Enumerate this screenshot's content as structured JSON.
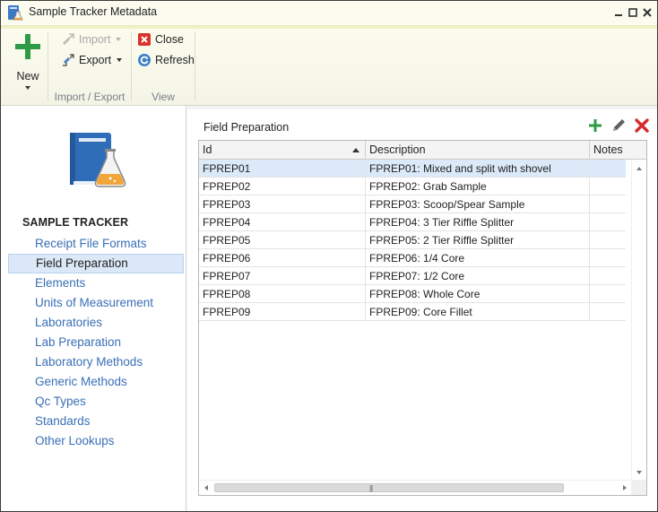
{
  "window": {
    "title": "Sample Tracker Metadata"
  },
  "ribbon": {
    "new_label": "New",
    "import_label": "Import",
    "export_label": "Export",
    "close_label": "Close",
    "refresh_label": "Refresh",
    "group_import_export": "Import / Export",
    "group_view": "View"
  },
  "nav": {
    "title": "SAMPLE TRACKER",
    "items": [
      "Receipt File Formats",
      "Field Preparation",
      "Elements",
      "Units of Measurement",
      "Laboratories",
      "Lab Preparation",
      "Laboratory Methods",
      "Generic Methods",
      "Qc Types",
      "Standards",
      "Other Lookups"
    ],
    "selected": "Field Preparation"
  },
  "content": {
    "title": "Field Preparation",
    "columns": [
      "Id",
      "Description",
      "Notes"
    ],
    "rows": [
      {
        "id": "FPREP01",
        "description": "FPREP01: Mixed and split with shovel",
        "notes": ""
      },
      {
        "id": "FPREP02",
        "description": "FPREP02: Grab Sample",
        "notes": ""
      },
      {
        "id": "FPREP03",
        "description": "FPREP03: Scoop/Spear Sample",
        "notes": ""
      },
      {
        "id": "FPREP04",
        "description": "FPREP04: 3 Tier Riffle Splitter",
        "notes": ""
      },
      {
        "id": "FPREP05",
        "description": "FPREP05: 2 Tier Riffle Splitter",
        "notes": ""
      },
      {
        "id": "FPREP06",
        "description": "FPREP06: 1/4 Core",
        "notes": ""
      },
      {
        "id": "FPREP07",
        "description": "FPREP07: 1/2 Core",
        "notes": ""
      },
      {
        "id": "FPREP08",
        "description": "FPREP08: Whole Core",
        "notes": ""
      },
      {
        "id": "FPREP09",
        "description": "FPREP09: Core Fillet",
        "notes": ""
      }
    ],
    "selected_row": "FPREP01"
  },
  "colors": {
    "nav_link": "#3a6fb6",
    "selection": "#dbe9f8",
    "add": "#2e9a46",
    "delete": "#d62b2b"
  },
  "icons": {
    "new": "plus-icon",
    "import": "import-icon",
    "export": "export-icon",
    "close": "close-red-icon",
    "refresh": "refresh-icon",
    "add": "add-icon",
    "edit": "pencil-icon",
    "delete": "delete-icon"
  }
}
